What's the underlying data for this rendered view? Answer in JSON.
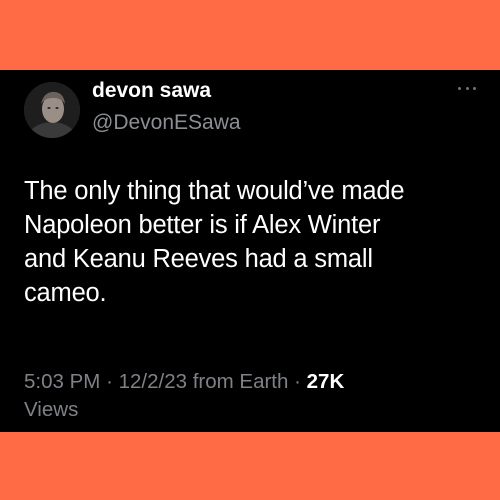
{
  "tweet": {
    "author": {
      "display_name": "devon sawa",
      "handle": "@DevonESawa",
      "avatar_icon": "profile-photo"
    },
    "text_lines": [
      "The only thing that would’ve made",
      "Napoleon better is if Alex Winter",
      "and Keanu Reeves had a small",
      "cameo."
    ],
    "time": "5:03 PM",
    "date": "12/2/23",
    "location": "from Earth",
    "separator": "·",
    "views_count": "27K",
    "views_label": "Views"
  },
  "colors": {
    "background": "#ff6b45",
    "card": "#000000",
    "text": "#ffffff",
    "muted": "#7e8286"
  }
}
